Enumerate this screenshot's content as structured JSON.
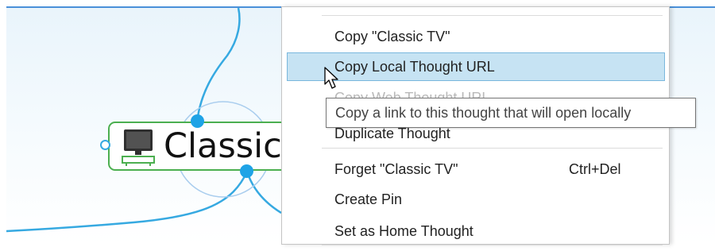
{
  "thought": {
    "label": "Classic",
    "icon": "tv-icon",
    "border_color": "#4caf50"
  },
  "link_color": "#36a9e1",
  "context_menu": {
    "items": [
      {
        "label": "Copy \"Classic TV\"",
        "shortcut": "",
        "state": "normal"
      },
      {
        "label": "Copy Local Thought URL",
        "shortcut": "",
        "state": "highlighted"
      },
      {
        "label": "Copy Web Thought URL",
        "shortcut": "",
        "state": "obscured"
      },
      {
        "label": "Duplicate Thought",
        "shortcut": "",
        "state": "obscured"
      },
      {
        "label": "Forget \"Classic TV\"",
        "shortcut": "Ctrl+Del",
        "state": "normal"
      },
      {
        "label": "Create Pin",
        "shortcut": "",
        "state": "normal"
      },
      {
        "label": "Set as Home Thought",
        "shortcut": "",
        "state": "normal"
      }
    ],
    "highlight_color": "#c6e3f3"
  },
  "tooltip": {
    "text": "Copy a link to this thought that will open locally"
  },
  "cursor": "arrow-pointer-icon"
}
